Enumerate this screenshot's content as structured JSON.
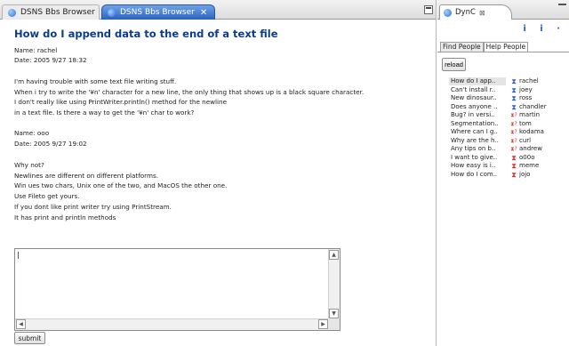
{
  "editor": {
    "tabs": [
      {
        "label": "DSNS Bbs Browser",
        "active": false
      },
      {
        "label": "DSNS Bbs Browser",
        "active": true,
        "close": "✕"
      }
    ],
    "post": {
      "title": "How do I append data to the end of a text file",
      "lines": [
        "Name: rachel",
        "Date: 2005 9/27 18:32",
        "",
        "I'm having trouble with some text file writing stuff.",
        "When i try to write the '¥n' character for a new line, the only thing that shows up is a black square character.",
        "I don't really like using PrintWriter.println() method for the newline",
        "in a text file. Is there a way to get the '¥n' char to work?",
        "",
        "Name: ooo",
        "Date: 2005 9/27 19:02",
        "",
        "Why not?",
        "Newlines are different on different platforms.",
        "Win ues two chars, Unix one of the two, and MacOS the other one.",
        "Use Fileto get yours.",
        "If you dont like print writer try using PrintStream.",
        "It has print and println methods"
      ]
    },
    "reply_text": "|",
    "submit_label": "submit"
  },
  "view": {
    "tab_label": "DynC",
    "tab_close": "⊠",
    "toolbar_glyphs": "i i ·",
    "panel_tabs": [
      "Find People",
      "Help People"
    ],
    "active_panel_tab": "Help People",
    "reload_label": "reload",
    "threads": [
      {
        "title": "How do I app..",
        "user": "rachel",
        "icon": "hourglass-icon",
        "color": "#2d5fd0",
        "selected": true
      },
      {
        "title": "Can't install r..",
        "user": "joey",
        "icon": "hourglass-icon",
        "color": "#2d5fd0"
      },
      {
        "title": "New dinosaur..",
        "user": "ross",
        "icon": "hourglass-icon",
        "color": "#2d5fd0"
      },
      {
        "title": "Does anyone ..",
        "user": "chandler",
        "icon": "hourglass-icon",
        "color": "#2d5fd0"
      },
      {
        "title": "Bug? in versi..",
        "user": "martin",
        "icon": "hourglass-question-icon",
        "color": "#e0302a"
      },
      {
        "title": "Segmentation..",
        "user": "tom",
        "icon": "hourglass-question-icon",
        "color": "#e0302a"
      },
      {
        "title": "Where can I g..",
        "user": "kodama",
        "icon": "hourglass-question-icon",
        "color": "#e0302a"
      },
      {
        "title": "Why are the h..",
        "user": "curl",
        "icon": "hourglass-question-icon",
        "color": "#e0302a"
      },
      {
        "title": "Any tips on b..",
        "user": "andrew",
        "icon": "hourglass-question-icon",
        "color": "#e0302a"
      },
      {
        "title": "I want to give..",
        "user": "o00o",
        "icon": "hourglass-icon",
        "color": "#e0302a"
      },
      {
        "title": "How easy is i..",
        "user": "meme",
        "icon": "hourglass-icon",
        "color": "#e0302a"
      },
      {
        "title": "How do I com..",
        "user": "jojo",
        "icon": "hourglass-icon",
        "color": "#e0302a"
      }
    ]
  }
}
